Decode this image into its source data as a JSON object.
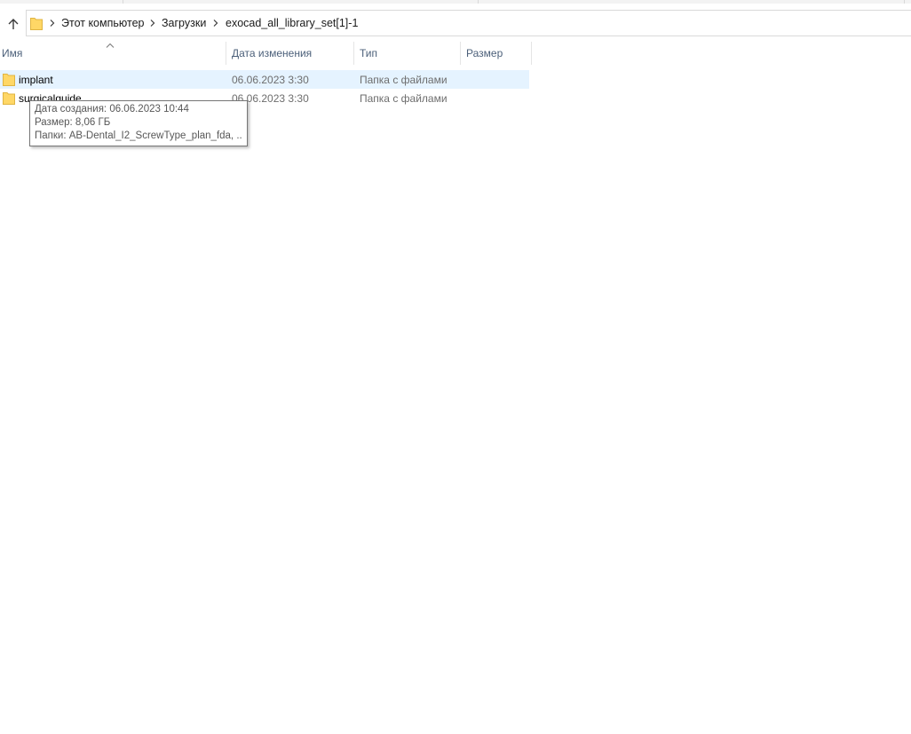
{
  "breadcrumb": {
    "items": [
      "Этот компьютер",
      "Загрузки",
      "exocad_all_library_set[1]-1"
    ]
  },
  "columns": {
    "name": "Имя",
    "date": "Дата изменения",
    "type": "Тип",
    "size": "Размер"
  },
  "rows": [
    {
      "name": "implant",
      "date": "06.06.2023 3:30",
      "type": "Папка с файлами",
      "selected": true
    },
    {
      "name": "surgicalguide",
      "date": "06.06.2023 3:30",
      "type": "Папка с файлами",
      "selected": false
    }
  ],
  "tooltip": {
    "created": "Дата создания: 06.06.2023 10:44",
    "size": "Размер: 8,06 ГБ",
    "folders": "Папки: AB-Dental_I2_ScrewType_plan_fda, ..."
  },
  "colors": {
    "selection": "#e5f3ff",
    "folder": "#ffd766",
    "header_text": "#4c607a"
  },
  "icons": {
    "up": "arrow-up-icon",
    "folder": "folder-icon",
    "chevron": "chevron-right-icon",
    "sort": "sort-ascending-icon"
  }
}
